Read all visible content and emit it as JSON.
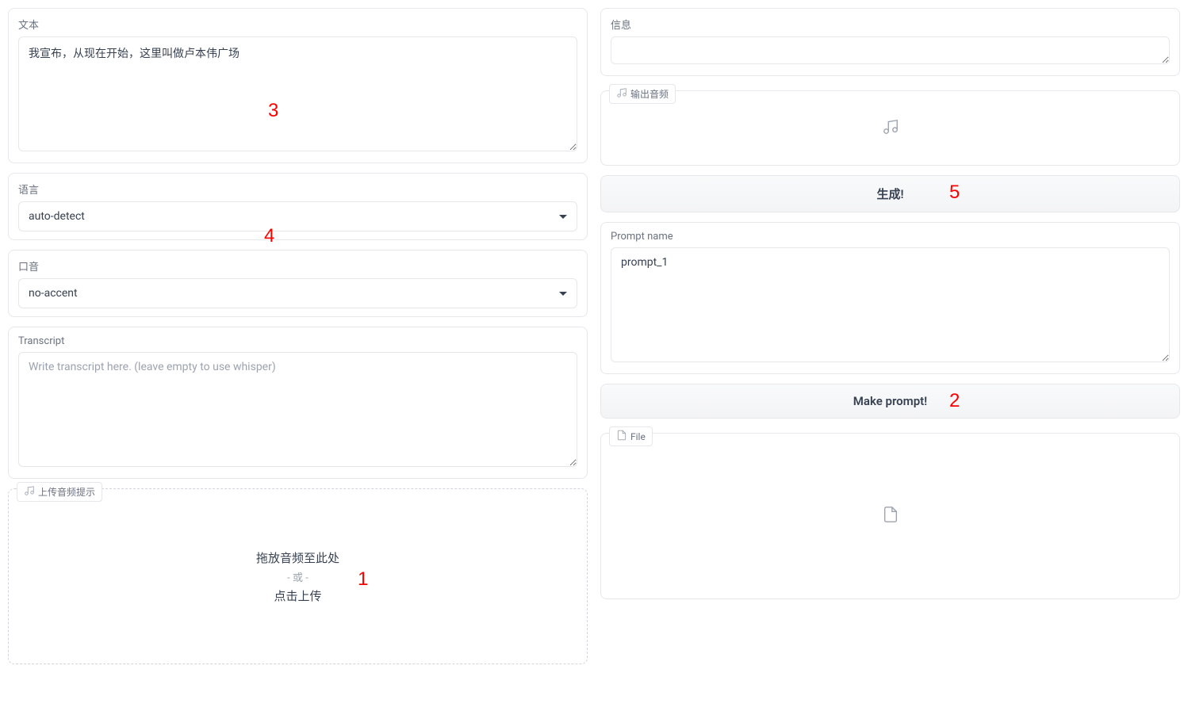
{
  "left": {
    "text_label": "文本",
    "text_value": "我宣布，从现在开始，这里叫做卢本伟广场",
    "language_label": "语言",
    "language_value": "auto-detect",
    "accent_label": "口音",
    "accent_value": "no-accent",
    "transcript_label": "Transcript",
    "transcript_placeholder": "Write transcript here. (leave empty to use whisper)",
    "upload_tab_label": "上传音频提示",
    "upload_line1": "拖放音频至此处",
    "upload_or": "- 或 -",
    "upload_line2": "点击上传"
  },
  "right": {
    "info_label": "信息",
    "output_audio_label": "输出音频",
    "generate_button": "生成!",
    "prompt_name_label": "Prompt name",
    "prompt_name_value": "prompt_1",
    "make_prompt_button": "Make prompt!",
    "file_label": "File"
  },
  "annotations": {
    "a1": "1",
    "a2": "2",
    "a3": "3",
    "a4": "4",
    "a5": "5"
  }
}
